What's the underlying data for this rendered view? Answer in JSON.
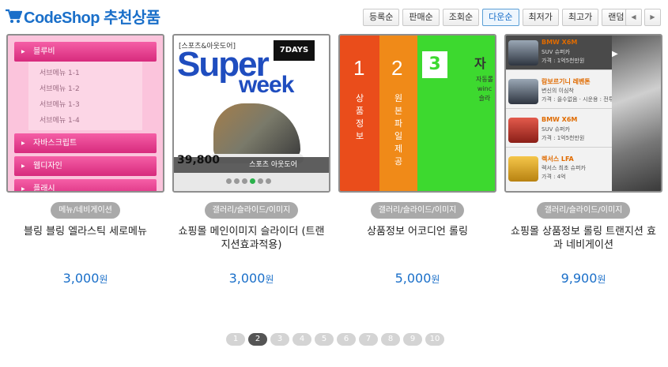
{
  "header": {
    "title": "CodeShop 추천상품"
  },
  "sort_buttons": [
    "등록순",
    "판매순",
    "조회순",
    "다운순",
    "최저가",
    "최고가",
    "랜덤"
  ],
  "sort_active": "다운순",
  "nav": {
    "prev": "◀",
    "next": "▶"
  },
  "products": [
    {
      "category": "메뉴/네비게이션",
      "title": "블링 블링 엘라스틱 세로메뉴",
      "price": "3,000",
      "unit": "원"
    },
    {
      "category": "갤러리/슬라이드/이미지",
      "title": "쇼핑몰 메인이미지 슬라이더 (트랜지션효과적용)",
      "price": "3,000",
      "unit": "원"
    },
    {
      "category": "갤러리/슬라이드/이미지",
      "title": "상품정보 어코디언 롤링",
      "price": "5,000",
      "unit": "원"
    },
    {
      "category": "갤러리/슬라이드/이미지",
      "title": "쇼핑몰 상품정보 롤링 트랜지션 효과 네비게이션",
      "price": "9,900",
      "unit": "원"
    }
  ],
  "thumb1": {
    "menus": [
      "블루비",
      "자바스크립트",
      "웹디자인",
      "플래시"
    ],
    "submenus": [
      "서브메뉴 1-1",
      "서브메뉴 1-2",
      "서브메뉴 1-3",
      "서브메뉴 1-4"
    ]
  },
  "thumb2": {
    "tag": "[스포츠&아웃도어]",
    "days": "7DAYS",
    "super": "Super",
    "week": "week",
    "price_tag": "39,800",
    "caption": "스포츠 아웃도어"
  },
  "thumb3": {
    "n1": "1",
    "n2": "2",
    "n3": "3",
    "v1": "상품정보",
    "v2": "원본파일제공",
    "side": "자",
    "side_sub": "자동롤 winc 슬라"
  },
  "thumb4": {
    "items": [
      {
        "name": "BMW X6M",
        "d1": "SUV 슈퍼카",
        "d2": "가격 : 1억5천만원"
      },
      {
        "name": "람보르기니 레벤톤",
        "d1": "변신의 이심착",
        "d2": "가격 : 을수없음 · 시운용 : 전투기"
      },
      {
        "name": "BMW X6M",
        "d1": "SUV 슈퍼카",
        "d2": "가격 : 1억5천만원"
      },
      {
        "name": "렉서스 LFA",
        "d1": "렉서스 최초 슈퍼카",
        "d2": "가격 : 4억"
      }
    ]
  },
  "pagination": {
    "pages": [
      "1",
      "2",
      "3",
      "4",
      "5",
      "6",
      "7",
      "8",
      "9",
      "10"
    ],
    "current": "2"
  }
}
